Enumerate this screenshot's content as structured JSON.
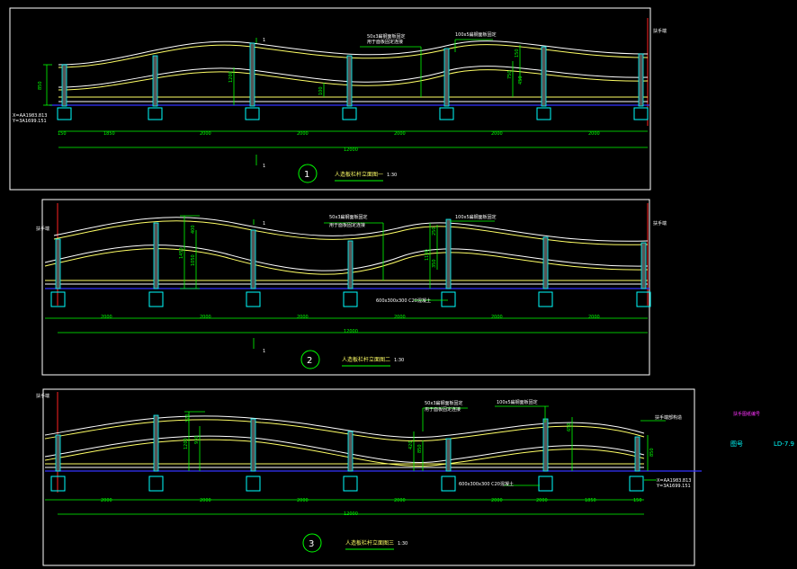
{
  "elevations": [
    {
      "number": "1",
      "title": "人造板栏杆立面图一",
      "scale": "1:30",
      "total": "12000",
      "spans": [
        "150",
        "1850",
        "2000",
        "2000",
        "2000",
        "2000",
        "2000"
      ],
      "callout_a": "50x3扁钢面板固定",
      "callout_a2": "用于面板固定连接",
      "callout_b": "100x5扁钢面板固定",
      "height_label": "850",
      "dim_a": "1200",
      "dim_b": "150",
      "dim_c": "750",
      "dim_d": "100",
      "dim_e": "450",
      "section_mark": "1",
      "right_label": "扶手端",
      "left_note_1": "X=AA1983.813",
      "left_note_2": "Y=3A1699.151"
    },
    {
      "number": "2",
      "title": "人造板栏杆立面图二",
      "scale": "1:30",
      "total": "12000",
      "spans": [
        "2000",
        "2000",
        "2000",
        "2000",
        "2000",
        "2000"
      ],
      "callout_a": "50x3扁钢面板固定",
      "callout_a2": "用于面板固定连接",
      "callout_b": "100x5扁钢面板固定",
      "footing_note": "600x300x300 C20混凝土",
      "dim_a": "1450",
      "dim_b": "1050",
      "dim_c": "400",
      "dim_d": "1100",
      "dim_e": "250",
      "dim_f": "350",
      "section_mark": "1",
      "left_label": "扶手端",
      "right_label": "扶手端"
    },
    {
      "number": "3",
      "title": "人造板栏杆立面图三",
      "scale": "1:30",
      "total": "12000",
      "spans": [
        "2000",
        "2000",
        "2000",
        "2000",
        "2000",
        "2000",
        "1850",
        "150"
      ],
      "callout_a": "50x3扁钢面板固定",
      "callout_a2": "用于面板固定连接",
      "callout_b": "100x5扁钢面板固定",
      "footing_note": "600x300x300 C20混凝土",
      "dim_a": "1200",
      "dim_b": "930",
      "dim_c": "370",
      "dim_d": "850",
      "dim_e": "420",
      "dim_f": "650",
      "right_note_top": "扶手端部构造",
      "right_note_1": "X=AA1983.813",
      "right_note_2": "Y=3A1699.151",
      "left_label": "扶手端"
    }
  ],
  "side": {
    "magenta_label": "扶手图纸编号",
    "label": "图号",
    "code": "LD-7.9"
  },
  "colors": {
    "frame": "#ffffff",
    "rail_primary": "#ffff66",
    "rail_secondary": "#ffffff",
    "dimension": "#00ff00",
    "ground": "#3333ff",
    "post": "#00ffff",
    "marker": "#ff2222",
    "accent_text": "#ff33ff"
  }
}
